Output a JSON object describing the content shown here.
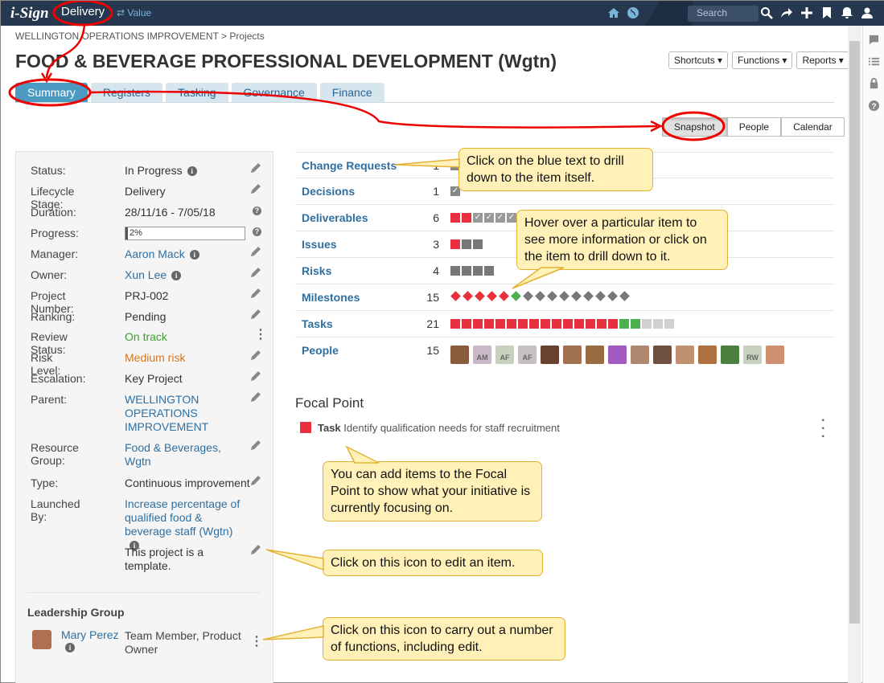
{
  "app": {
    "logo": "i-Sign",
    "mode": "Delivery",
    "value_link": "⇄ Value",
    "search_placeholder": "Search"
  },
  "breadcrumb": "WELLINGTON OPERATIONS IMPROVEMENT > Projects",
  "title": "FOOD & BEVERAGE PROFESSIONAL DEVELOPMENT (Wgtn)",
  "header_buttons": [
    "Shortcuts ▾",
    "Functions ▾",
    "Reports ▾"
  ],
  "tabs": [
    "Summary",
    "Registers",
    "Tasking",
    "Governance",
    "Finance"
  ],
  "active_tab": "Summary",
  "view_buttons": [
    "Snapshot",
    "People",
    "Calendar"
  ],
  "active_view": "Snapshot",
  "properties": [
    {
      "label": "Status:",
      "value": "In Progress"
    },
    {
      "label": "Lifecycle Stage:",
      "value": "Delivery"
    },
    {
      "label": "Duration:",
      "value": "28/11/16 - 7/05/18"
    },
    {
      "label": "Progress:",
      "value": "2%",
      "progress": 0.02
    },
    {
      "label": "Manager:",
      "value": "Aaron Mack"
    },
    {
      "label": "Owner:",
      "value": "Xun Lee"
    },
    {
      "label": "Project Number:",
      "value": "PRJ-002"
    },
    {
      "label": "Ranking:",
      "value": "Pending"
    },
    {
      "label": "Review Status:",
      "value": "On track",
      "color": "#3f9c35"
    },
    {
      "label": "Risk Level:",
      "value": "Medium risk",
      "color": "#d4751a"
    },
    {
      "label": "Escalation:",
      "value": "Key Project"
    },
    {
      "label": "Parent:",
      "value": "WELLINGTON OPERATIONS IMPROVEMENT"
    },
    {
      "label": "Resource Group:",
      "value": "Food & Beverages, Wgtn"
    },
    {
      "label": "Type:",
      "value": "Continuous improvement"
    },
    {
      "label": "Launched By:",
      "value": "Increase percentage of qualified food & beverage staff (Wgtn)"
    },
    {
      "label": "",
      "value": "This project is a template."
    }
  ],
  "leadership": {
    "title": "Leadership Group",
    "members": [
      {
        "name": "Mary Perez",
        "role": "Team Member, Product Owner"
      }
    ]
  },
  "registers": [
    {
      "name": "Change Requests",
      "count": "1"
    },
    {
      "name": "Decisions",
      "count": "1"
    },
    {
      "name": "Deliverables",
      "count": "6"
    },
    {
      "name": "Issues",
      "count": "3"
    },
    {
      "name": "Risks",
      "count": "4"
    },
    {
      "name": "Milestones",
      "count": "15"
    },
    {
      "name": "Tasks",
      "count": "21"
    },
    {
      "name": "People",
      "count": "15"
    }
  ],
  "people_initials": [
    "",
    "AM",
    "AF",
    "AF",
    "",
    "",
    "",
    "",
    "",
    "",
    "",
    "",
    "",
    "RW",
    ""
  ],
  "focal": {
    "title": "Focal Point",
    "type": "Task",
    "text": "Identify qualification needs for staff recruitment"
  },
  "callouts": {
    "c1": "Click on the blue text to drill down to the item itself.",
    "c2": "Hover over a particular item to see more information or click on the item to drill down to it.",
    "c3": "You can add items to the Focal Point to show what your initiative is currently focusing on.",
    "c4": "Click on this icon to edit an item.",
    "c5": "Click on this icon to carry out a number of functions, including edit."
  },
  "colors": {
    "red": "#e8313d",
    "gray": "#777777",
    "green": "#4caf50",
    "light": "#d0d0d0",
    "accent": "#2f6fa0",
    "topbar": "#25384f"
  }
}
